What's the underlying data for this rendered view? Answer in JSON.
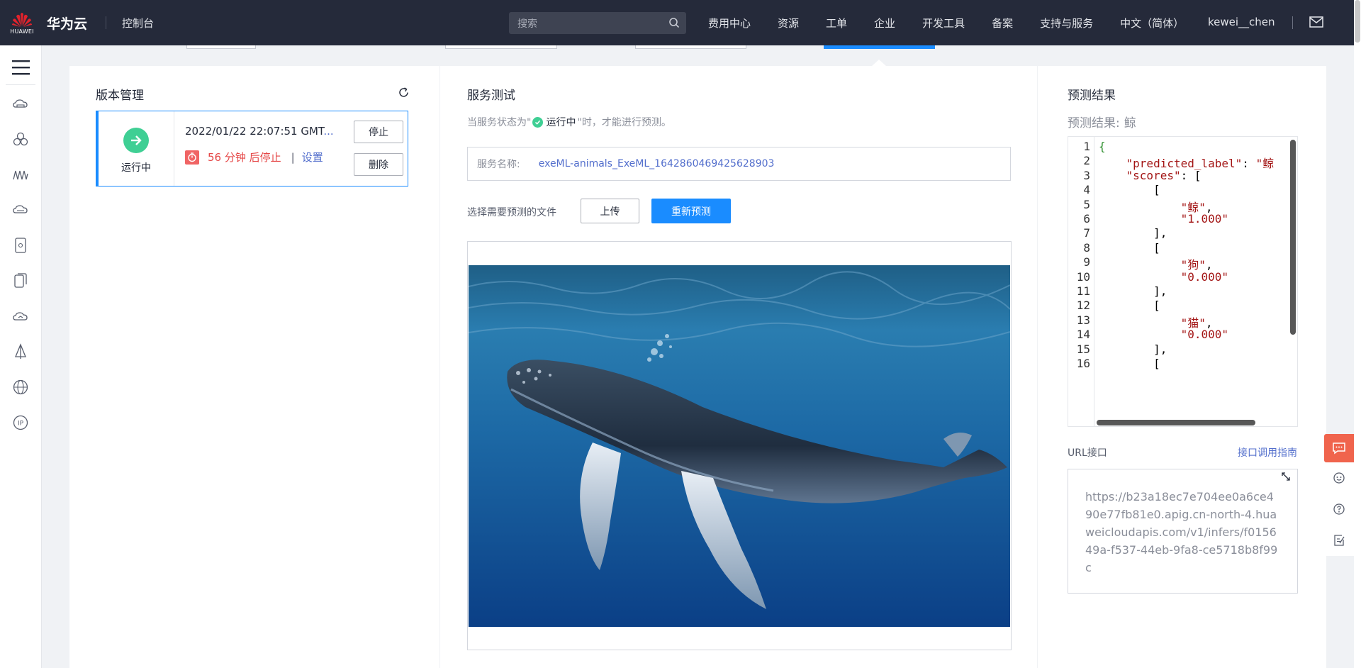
{
  "topbar": {
    "logo_text": "HUAWEI",
    "brand": "华为云",
    "console": "控制台",
    "search_placeholder": "搜索",
    "nav": [
      "费用中心",
      "资源",
      "工单",
      "企业",
      "开发工具",
      "备案",
      "支持与服务",
      "中文（简体）"
    ],
    "user": "kewei__chen"
  },
  "sidebar": {
    "icons": [
      "menu-icon",
      "cloud-icon",
      "nodes-icon",
      "analytics-icon",
      "cloud-icon",
      "device-icon",
      "devices-icon",
      "cloud-service-icon",
      "sail-icon",
      "globe-icon",
      "ip-icon"
    ]
  },
  "version": {
    "title": "版本管理",
    "status": "运行中",
    "time": "2022/01/22 22:07:51 GMT",
    "time_ellipsis": "...",
    "stop_minutes": "56 分钟 后停止",
    "pipe": "|",
    "settings": "设置",
    "stop_btn": "停止",
    "delete_btn": "删除"
  },
  "service": {
    "title": "服务测试",
    "hint_prefix": "当服务状态为\"",
    "hint_status": "运行中",
    "hint_suffix": "\"时，才能进行预测。",
    "name_label": "服务名称:",
    "name_value": "exeML-animals_ExeML_1642860469425628903",
    "file_label": "选择需要预测的文件",
    "upload_btn": "上传",
    "repredict_btn": "重新预测"
  },
  "result": {
    "title": "预测结果",
    "label": "预测结果:",
    "value": "鲸",
    "code_lines": [
      {
        "n": "1",
        "t": "{"
      },
      {
        "n": "2",
        "t": "    \"predicted_label\": \"鲸"
      },
      {
        "n": "3",
        "t": "    \"scores\": ["
      },
      {
        "n": "4",
        "t": "        ["
      },
      {
        "n": "5",
        "t": "            \"鲸\","
      },
      {
        "n": "6",
        "t": "            \"1.000\""
      },
      {
        "n": "7",
        "t": "        ],"
      },
      {
        "n": "8",
        "t": "        ["
      },
      {
        "n": "9",
        "t": "            \"狗\","
      },
      {
        "n": "10",
        "t": "            \"0.000\""
      },
      {
        "n": "11",
        "t": "        ],"
      },
      {
        "n": "12",
        "t": "        ["
      },
      {
        "n": "13",
        "t": "            \"猫\","
      },
      {
        "n": "14",
        "t": "            \"0.000\""
      },
      {
        "n": "15",
        "t": "        ],"
      },
      {
        "n": "16",
        "t": "        ["
      }
    ],
    "url_label": "URL接口",
    "url_link": "接口调用指南",
    "url_value": "https://b23a18ec7e704ee0a6ce490e77fb81e0.apig.cn-north-4.huaweicloudapis.com/v1/infers/f015649a-f537-44eb-9fa8-ce5718b8f99c"
  },
  "colors": {
    "accent": "#1a8cff",
    "running": "#3fcf94",
    "danger": "#e54545",
    "topbar": "#252a3a"
  }
}
